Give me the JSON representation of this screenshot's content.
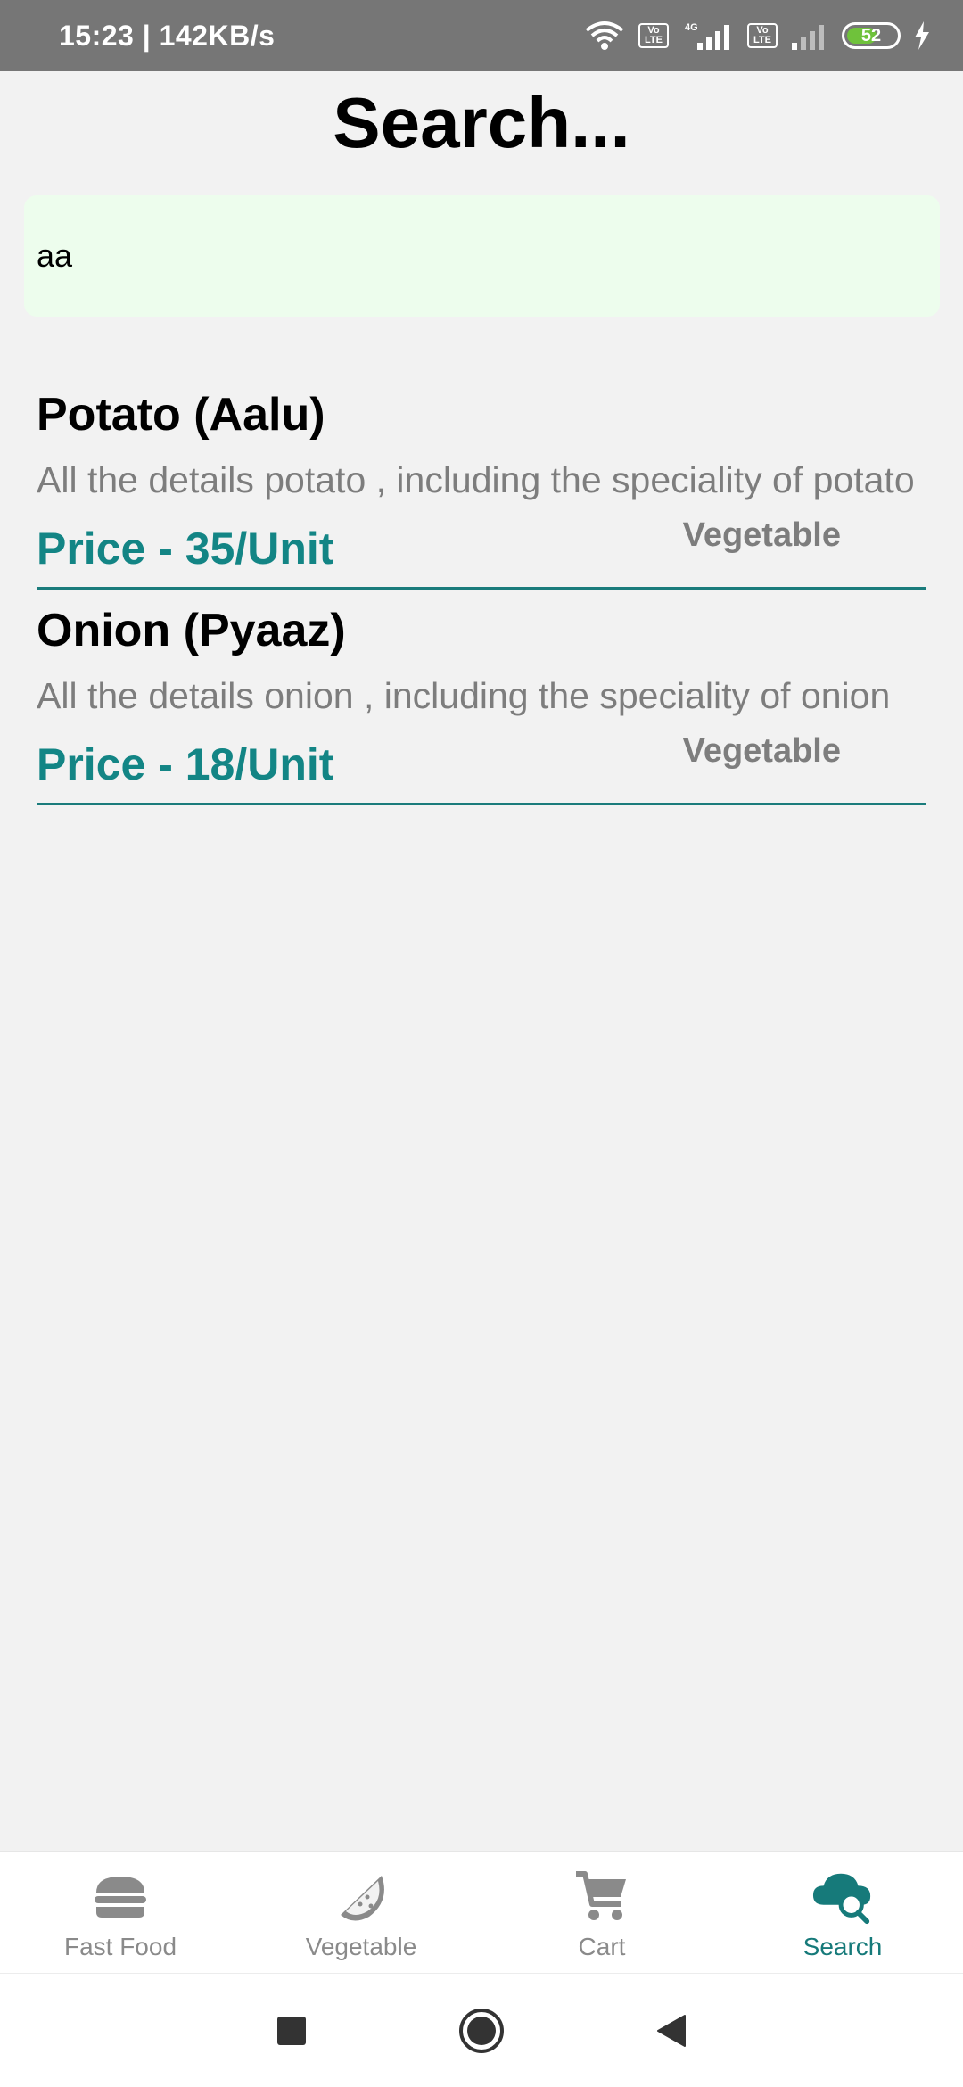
{
  "status_bar": {
    "time_speed": "15:23 | 142KB/s",
    "volte_1": "Vo LTE",
    "network_4g": "4G",
    "volte_2": "Vo LTE",
    "battery_level": "52"
  },
  "page": {
    "title": "Search..."
  },
  "search": {
    "value": "aa",
    "placeholder": ""
  },
  "results": [
    {
      "name": "Potato (Aalu)",
      "description": "All the details potato , including the speciality of potato",
      "price": "Price - 35/Unit",
      "category": "Vegetable"
    },
    {
      "name": "Onion (Pyaaz)",
      "description": "All the details onion , including the speciality of onion",
      "price": "Price - 18/Unit",
      "category": "Vegetable"
    }
  ],
  "bottom_nav": {
    "items": [
      {
        "label": "Fast Food",
        "icon": "burger-icon"
      },
      {
        "label": "Vegetable",
        "icon": "watermelon-icon"
      },
      {
        "label": "Cart",
        "icon": "cart-icon"
      },
      {
        "label": "Search",
        "icon": "cloud-search-icon"
      }
    ],
    "active_index": 3,
    "active_color": "#167a7a",
    "inactive_color": "#8a8a8a"
  },
  "system_nav": {
    "buttons": [
      "recents-square-icon",
      "home-circle-icon",
      "back-triangle-icon"
    ]
  },
  "colors": {
    "accent": "#138585",
    "search_bg": "#edfded",
    "status_bar": "#767676"
  }
}
